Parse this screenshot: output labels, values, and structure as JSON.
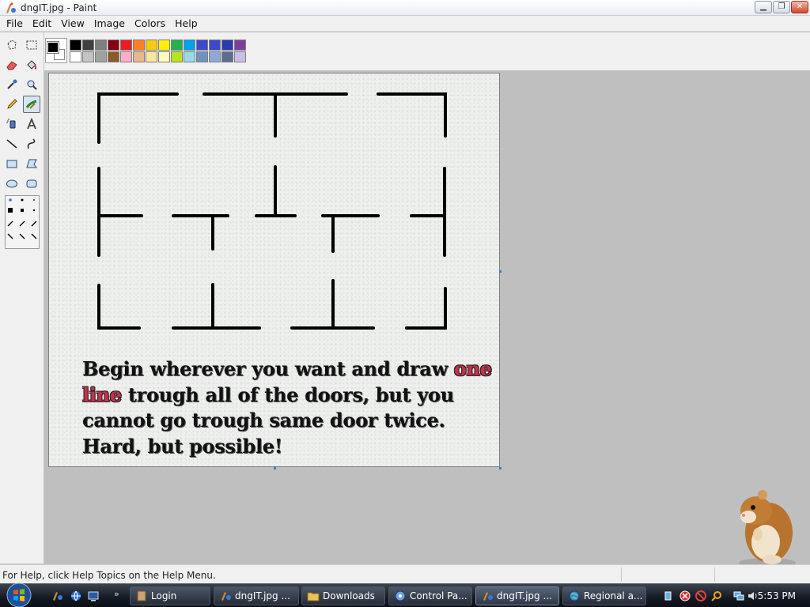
{
  "window": {
    "title": "dngIT.jpg - Paint"
  },
  "menu": [
    "File",
    "Edit",
    "View",
    "Image",
    "Colors",
    "Help"
  ],
  "tools": [
    {
      "name": "free-form-select",
      "icon": "free-select-icon"
    },
    {
      "name": "select",
      "icon": "rect-select-icon"
    },
    {
      "name": "eraser",
      "icon": "eraser-icon"
    },
    {
      "name": "fill-with-color",
      "icon": "fill-bucket-icon"
    },
    {
      "name": "pick-color",
      "icon": "eyedropper-icon"
    },
    {
      "name": "magnifier",
      "icon": "magnifier-icon"
    },
    {
      "name": "pencil",
      "icon": "pencil-icon"
    },
    {
      "name": "brush",
      "icon": "brush-icon",
      "active": true
    },
    {
      "name": "airbrush",
      "icon": "airbrush-icon"
    },
    {
      "name": "text",
      "icon": "text-icon"
    },
    {
      "name": "line",
      "icon": "line-icon"
    },
    {
      "name": "curve",
      "icon": "curve-icon"
    },
    {
      "name": "rectangle",
      "icon": "rectangle-icon"
    },
    {
      "name": "polygon",
      "icon": "polygon-icon"
    },
    {
      "name": "ellipse",
      "icon": "ellipse-icon"
    },
    {
      "name": "rounded-rectangle",
      "icon": "rounded-rect-icon"
    }
  ],
  "colors": {
    "foreground": "#000000",
    "background": "#ffffff",
    "palette_row1": [
      "#000000",
      "#404040",
      "#7f7f7f",
      "#880015",
      "#ed1c24",
      "#ff7f27",
      "#ffc90e",
      "#fff200",
      "#22b14c",
      "#00a2e8",
      "#3f48cc",
      "#3f48cc",
      "#2a3bb0",
      "#7f3f98"
    ],
    "palette_row2": [
      "#ffffff",
      "#c3c3c3",
      "#a0a0a0",
      "#8b5a2b",
      "#ffaec9",
      "#e6b98a",
      "#ffe59e",
      "#fffac0",
      "#b5e61d",
      "#99d9ea",
      "#7092be",
      "#8fa8d4",
      "#5c6f8f",
      "#c8bfe7"
    ]
  },
  "puzzle": {
    "line1a": "Begin wherever you want and draw ",
    "line1b": "one",
    "line2a": "line",
    "line2b": " trough all of the doors, but you",
    "line3": "cannot go trough same door twice.",
    "line4": "Hard, but possible!"
  },
  "status": {
    "help_text": "For Help, click Help Topics on the Help Menu."
  },
  "taskbar": {
    "buttons": [
      {
        "label": "Login",
        "icon": "login-icon"
      },
      {
        "label": "dngIT.jpg ...",
        "icon": "paint-icon"
      },
      {
        "label": "Downloads",
        "icon": "folder-icon"
      },
      {
        "label": "Control Pa...",
        "icon": "control-panel-icon"
      },
      {
        "label": "dngIT.jpg ...",
        "icon": "paint-icon",
        "active": true
      },
      {
        "label": "Regional a...",
        "icon": "regional-icon"
      }
    ],
    "clock": "5:53 PM"
  }
}
